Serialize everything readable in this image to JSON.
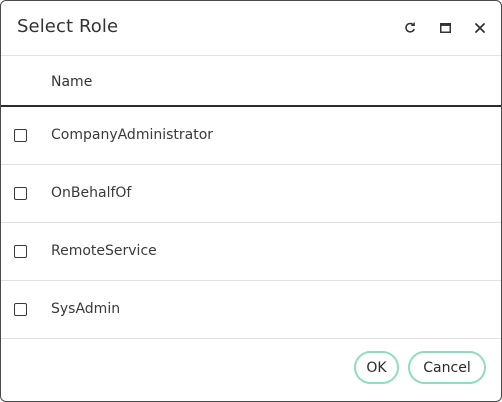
{
  "dialog": {
    "title": "Select Role",
    "titlebar_icons": [
      "refresh-icon",
      "maximize-icon",
      "close-icon"
    ]
  },
  "grid": {
    "columns": [
      "Name"
    ],
    "rows": [
      {
        "name": "CompanyAdministrator",
        "checked": false
      },
      {
        "name": "OnBehalfOf",
        "checked": false
      },
      {
        "name": "RemoteService",
        "checked": false
      },
      {
        "name": "SysAdmin",
        "checked": false
      }
    ]
  },
  "footer": {
    "ok_label": "OK",
    "cancel_label": "Cancel"
  },
  "colors": {
    "button_border": "#8fdcbf",
    "header_rule": "#2b2b2b"
  }
}
